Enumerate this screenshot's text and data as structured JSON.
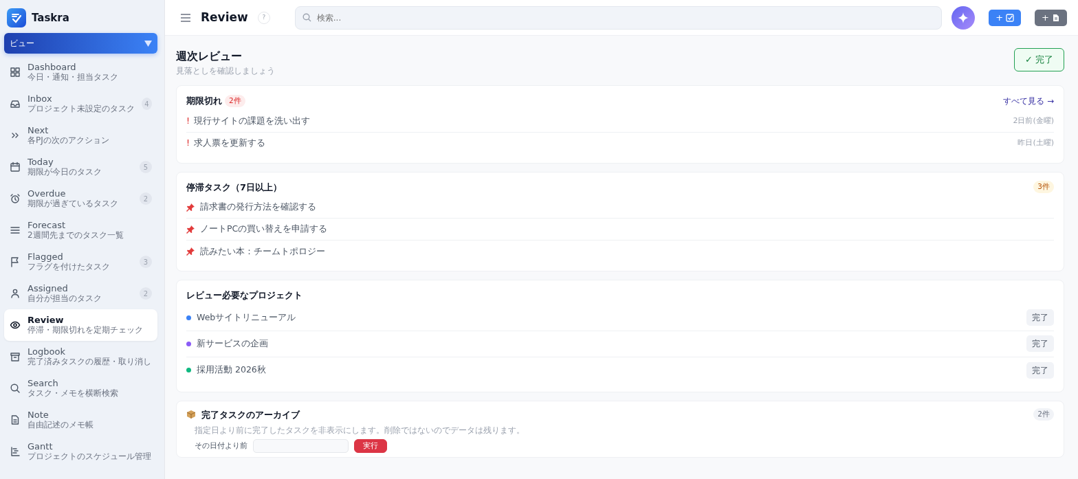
{
  "app": {
    "name": "Taskra"
  },
  "sidebar": {
    "view_select": "ビュー",
    "items": [
      {
        "label": "Dashboard",
        "sub": "今日・通知・担当タスク",
        "selected": false
      },
      {
        "label": "Inbox",
        "sub": "プロジェクト未設定のタスク",
        "count": "4",
        "selected": false
      },
      {
        "label": "Next",
        "sub": "各PJの次のアクション",
        "selected": false
      },
      {
        "label": "Today",
        "sub": "期限が今日のタスク",
        "count": "5",
        "selected": false
      },
      {
        "label": "Overdue",
        "sub": "期限が過ぎているタスク",
        "count": "2",
        "selected": false
      },
      {
        "label": "Forecast",
        "sub": "2週間先までのタスク一覧",
        "selected": false
      },
      {
        "label": "Flagged",
        "sub": "フラグを付けたタスク",
        "count": "3",
        "selected": false
      },
      {
        "label": "Assigned",
        "sub": "自分が担当のタスク",
        "count": "2",
        "selected": false
      },
      {
        "label": "Review",
        "sub": "停滞・期限切れを定期チェック",
        "selected": true
      },
      {
        "label": "Logbook",
        "sub": "完了済みタスクの履歴・取り消し",
        "selected": false
      },
      {
        "label": "Search",
        "sub": "タスク・メモを横断検索",
        "selected": false
      },
      {
        "label": "Note",
        "sub": "自由記述のメモ帳",
        "selected": false
      },
      {
        "label": "Gantt",
        "sub": "プロジェクトのスケジュール管理",
        "selected": false
      }
    ]
  },
  "header": {
    "title": "Review",
    "help": "?",
    "search": {
      "placeholder": "検索..."
    },
    "buttons": [
      {
        "kind": "ai"
      },
      {
        "kind": "task",
        "label": "+"
      },
      {
        "kind": "note",
        "label": "+"
      }
    ]
  },
  "review": {
    "title": "週次レビュー",
    "subtitle": "見落としを確認しましょう",
    "done_button": "完了",
    "done_mark": "✓"
  },
  "overdue": {
    "title": "期限切れ",
    "count": "2件",
    "link": "すべて見る →",
    "rows": [
      {
        "mark": "!",
        "text": "現行サイトの課題を洗い出す",
        "when": "2日前(金曜)"
      },
      {
        "mark": "!",
        "text": "求人票を更新する",
        "when": "昨日(土曜)"
      }
    ]
  },
  "stalled": {
    "title": "停滞タスク（7日以上）",
    "count": "3件",
    "rows": [
      {
        "text": "請求書の発行方法を確認する"
      },
      {
        "text": "ノートPCの買い替えを申請する"
      },
      {
        "text": "読みたい本：チームトポロジー"
      }
    ]
  },
  "projects": {
    "title": "レビュー必要なプロジェクト",
    "rows": [
      {
        "name": "Webサイトリニューアル",
        "color": "#3b82f6",
        "action": "完了"
      },
      {
        "name": "新サービスの企画",
        "color": "#8b5cf6",
        "action": "完了"
      },
      {
        "name": "採用活動 2026秋",
        "color": "#10b981",
        "action": "完了"
      }
    ]
  },
  "archive": {
    "title": "完了タスクのアーカイブ",
    "count": "2件",
    "description": "指定日より前に完了したタスクを非表示にします。削除ではないのでデータは残ります。",
    "date_label": "その日付より前",
    "run_button": "実行"
  }
}
